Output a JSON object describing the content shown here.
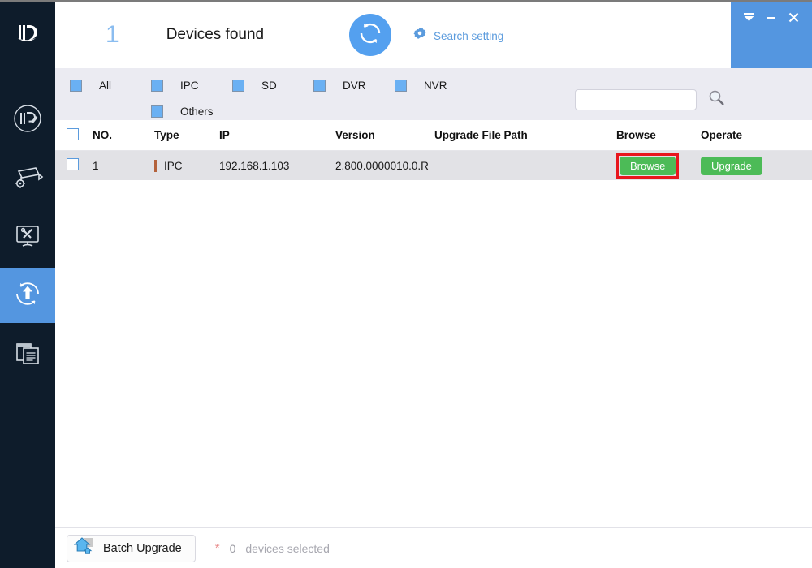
{
  "app": {
    "logo_icon": "dahua-logo-icon",
    "accent_blue": "#5496e0",
    "sidebar_bg": "#0e1c2b",
    "green": "#4cbb57",
    "highlight_red": "#e8161d"
  },
  "sidebar": {
    "items": [
      {
        "name": "modify-ip",
        "icon": "ip-pencil-icon",
        "active": false
      },
      {
        "name": "device-config",
        "icon": "camera-gear-icon",
        "active": false
      },
      {
        "name": "system-settings",
        "icon": "monitor-tools-icon",
        "active": false
      },
      {
        "name": "device-upgrade",
        "icon": "upload-arrow-circle-icon",
        "active": true
      },
      {
        "name": "device-logs",
        "icon": "documents-icon",
        "active": false
      }
    ]
  },
  "header": {
    "device_count": "1",
    "devices_found_label": "Devices found",
    "refresh_icon": "refresh-circle-icon",
    "search_setting_icon": "gear-icon",
    "search_setting_label": "Search setting",
    "window_controls": [
      {
        "name": "collapse-button",
        "icon": "collapse-icon"
      },
      {
        "name": "minimize-button",
        "icon": "minimize-icon"
      },
      {
        "name": "close-button",
        "icon": "close-icon"
      }
    ]
  },
  "filters": {
    "row1": [
      {
        "label": "All",
        "checked": true
      },
      {
        "label": "IPC",
        "checked": true
      },
      {
        "label": "SD",
        "checked": true
      },
      {
        "label": "DVR",
        "checked": true
      },
      {
        "label": "NVR",
        "checked": true
      }
    ],
    "row2": [
      {
        "label": "Others",
        "checked": true
      }
    ]
  },
  "search": {
    "value": "",
    "placeholder": "",
    "icon": "search-icon"
  },
  "table": {
    "columns": [
      "NO.",
      "Type",
      "IP",
      "Version",
      "Upgrade File Path",
      "Browse",
      "Operate"
    ],
    "rows": [
      {
        "selected": false,
        "no": "1",
        "type": "IPC",
        "ip": "192.168.1.103",
        "version": "2.800.0000010.0.R",
        "upgrade_file_path": "",
        "browse_label": "Browse",
        "operate_label": "Upgrade",
        "browse_highlighted": true
      }
    ]
  },
  "footer": {
    "batch_upgrade_label": "Batch Upgrade",
    "batch_icon": "upload-house-icon",
    "asterisk": "*",
    "selected_count": "0",
    "selected_text": "devices selected"
  }
}
